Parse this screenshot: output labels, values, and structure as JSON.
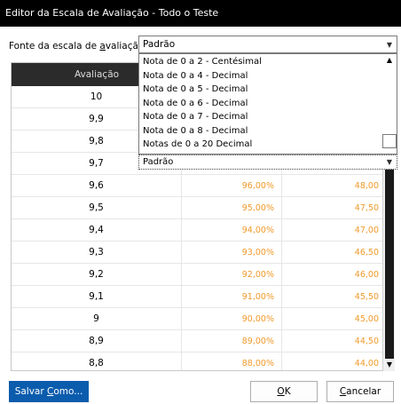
{
  "window": {
    "title": "Editor da Escala de Avaliação - Todo o Teste"
  },
  "source": {
    "label_pre": "Fonte da escala de ",
    "label_mnemonic": "a",
    "label_post": "valiação:",
    "selected": "Padrão"
  },
  "dropdown": {
    "items": [
      "Nota de 0 a 2 - Centésimal",
      "Nota de 0 a 4 - Decimal",
      "Nota de 0 a 5 - Decimal",
      "Nota de 0 a 6 - Decimal",
      "Nota de 0 a 7 - Decimal",
      "Nota de 0 a 8 - Decimal",
      "Notas de 0 a 20 Decimal"
    ]
  },
  "cell_editor": {
    "value": "Padrão"
  },
  "grid": {
    "header": {
      "col1": "Avaliação"
    },
    "rows": [
      {
        "grade": "10",
        "pct": "",
        "value": ""
      },
      {
        "grade": "9,9",
        "pct": "",
        "value": ""
      },
      {
        "grade": "9,8",
        "pct": "",
        "value": ""
      },
      {
        "grade": "9,7",
        "pct": "",
        "value": ""
      },
      {
        "grade": "9,6",
        "pct": "96,00%",
        "value": "48,00"
      },
      {
        "grade": "9,5",
        "pct": "95,00%",
        "value": "47,50"
      },
      {
        "grade": "9,4",
        "pct": "94,00%",
        "value": "47,00"
      },
      {
        "grade": "9,3",
        "pct": "93,00%",
        "value": "46,50"
      },
      {
        "grade": "9,2",
        "pct": "92,00%",
        "value": "46,00"
      },
      {
        "grade": "9,1",
        "pct": "91,00%",
        "value": "45,50"
      },
      {
        "grade": "9",
        "pct": "90,00%",
        "value": "45,00"
      },
      {
        "grade": "8,9",
        "pct": "89,00%",
        "value": "44,50"
      },
      {
        "grade": "8,8",
        "pct": "88,00%",
        "value": "44,00"
      }
    ]
  },
  "buttons": {
    "save_pre": "Salvar ",
    "save_mnemonic": "C",
    "save_post": "omo...",
    "ok_mnemonic": "O",
    "ok_post": "K",
    "cancel_mnemonic": "C",
    "cancel_post": "ancelar"
  },
  "colors": {
    "accent": "#0b5cad",
    "value_text": "#f09a2a",
    "header_bg": "#2b2b2b"
  }
}
